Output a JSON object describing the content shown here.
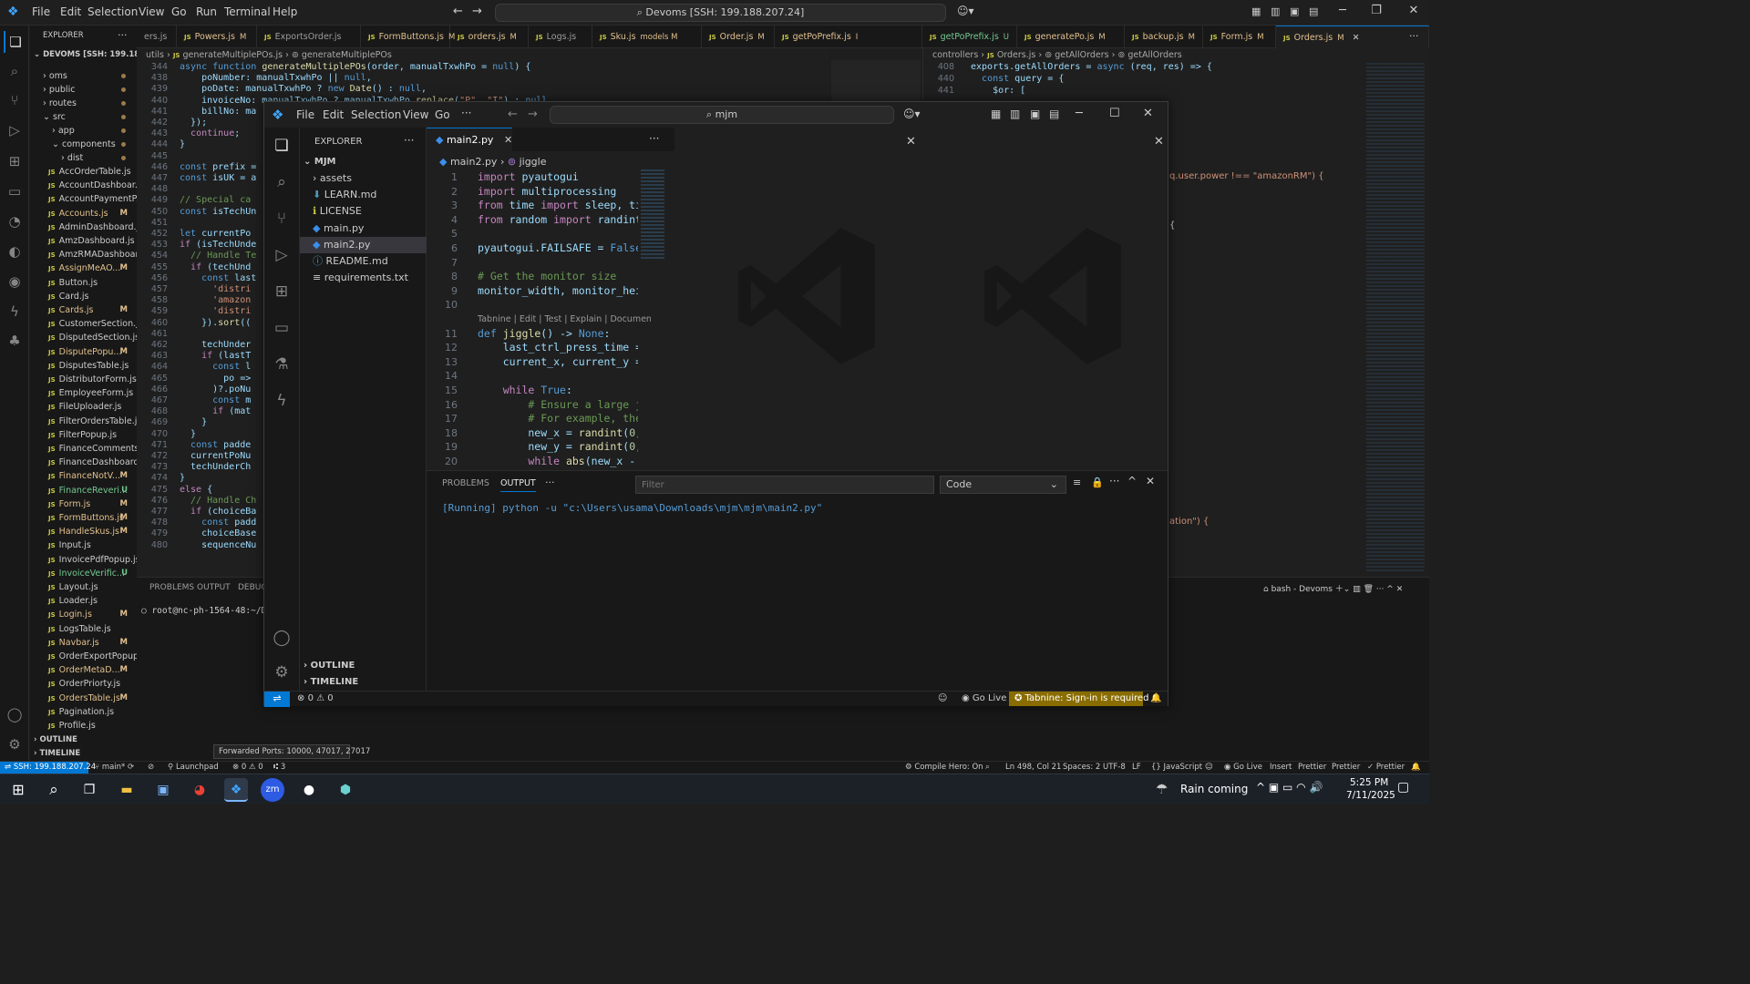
{
  "main": {
    "menu": [
      "File",
      "Edit",
      "Selection",
      "View",
      "Go",
      "Run",
      "Terminal",
      "Help"
    ],
    "search": "Devoms [SSH: 199.188.207.24]",
    "explorer_title": "EXPLORER",
    "workspace": "DEVOMS [SSH: 199.188.20...",
    "folders": [
      "oms",
      "public",
      "routes",
      "src",
      "app",
      "components",
      "dist"
    ],
    "files": [
      {
        "name": "AccOrderTable.js",
        "status": ""
      },
      {
        "name": "AccountDashboar...",
        "status": ""
      },
      {
        "name": "AccountPaymentP...",
        "status": ""
      },
      {
        "name": "Accounts.js",
        "status": "M"
      },
      {
        "name": "AdminDashboard.js",
        "status": ""
      },
      {
        "name": "AmzDashboard.js",
        "status": ""
      },
      {
        "name": "AmzRMADashboar...",
        "status": ""
      },
      {
        "name": "AssignMeAO...",
        "status": "M"
      },
      {
        "name": "Button.js",
        "status": ""
      },
      {
        "name": "Card.js",
        "status": ""
      },
      {
        "name": "Cards.js",
        "status": "M"
      },
      {
        "name": "CustomerSection.js",
        "status": ""
      },
      {
        "name": "DisputedSection.js",
        "status": ""
      },
      {
        "name": "DisputePopu...",
        "status": "M"
      },
      {
        "name": "DisputesTable.js",
        "status": ""
      },
      {
        "name": "DistributorForm.js",
        "status": ""
      },
      {
        "name": "EmployeeForm.js",
        "status": ""
      },
      {
        "name": "FileUploader.js",
        "status": ""
      },
      {
        "name": "FilterOrdersTable.js",
        "status": ""
      },
      {
        "name": "FilterPopup.js",
        "status": ""
      },
      {
        "name": "FinanceComments.js",
        "status": ""
      },
      {
        "name": "FinanceDashboard.js",
        "status": ""
      },
      {
        "name": "FinanceNotV...",
        "status": "M"
      },
      {
        "name": "FinanceReveri...",
        "status": "U"
      },
      {
        "name": "Form.js",
        "status": "M"
      },
      {
        "name": "FormButtons.js",
        "status": "M"
      },
      {
        "name": "HandleSkus.js",
        "status": "M"
      },
      {
        "name": "Input.js",
        "status": ""
      },
      {
        "name": "InvoicePdfPopup.js",
        "status": ""
      },
      {
        "name": "InvoiceVerific...",
        "status": "U"
      },
      {
        "name": "Layout.js",
        "status": ""
      },
      {
        "name": "Loader.js",
        "status": ""
      },
      {
        "name": "Login.js",
        "status": "M"
      },
      {
        "name": "LogsTable.js",
        "status": ""
      },
      {
        "name": "Navbar.js",
        "status": "M"
      },
      {
        "name": "OrderExportPopup.js",
        "status": ""
      },
      {
        "name": "OrderMetaD...",
        "status": "M"
      },
      {
        "name": "OrderPriorty.js",
        "status": ""
      },
      {
        "name": "OrdersTable.js",
        "status": "M"
      },
      {
        "name": "Pagination.js",
        "status": ""
      },
      {
        "name": "Profile.js",
        "status": ""
      }
    ],
    "outline": "OUTLINE",
    "timeline": "TIMELINE",
    "tabs": [
      {
        "name": "ers.js",
        "status": ""
      },
      {
        "name": "Powers.js",
        "status": "M"
      },
      {
        "name": "ExportsOrder.js",
        "status": ""
      },
      {
        "name": "FormButtons.js",
        "status": "M"
      },
      {
        "name": "orders.js",
        "status": "M"
      },
      {
        "name": "Logs.js",
        "status": ""
      },
      {
        "name": "Sku.js",
        "status": "models M"
      },
      {
        "name": "Order.js",
        "status": "M"
      },
      {
        "name": "getPoPrefix.js",
        "status": "I"
      },
      {
        "name": "getPoPrefix.js",
        "status": "U"
      },
      {
        "name": "generatePo.js",
        "status": "M"
      },
      {
        "name": "backup.js",
        "status": "M"
      },
      {
        "name": "Form.js",
        "status": "M"
      },
      {
        "name": "Orders.js",
        "status": "M"
      }
    ],
    "breadcrumb_left": [
      "utils",
      "generateMultiplePOs.js",
      "generateMultiplePOs"
    ],
    "breadcrumb_right": [
      "controllers",
      "Orders.js",
      "getAllOrders",
      "getAllOrders"
    ],
    "left_code": [
      {
        "n": "344",
        "t": "async function generateMultiplePOs(order, manualTxwhPo = null) {"
      },
      {
        "n": "438",
        "t": "    poNumber: manualTxwhPo || null,"
      },
      {
        "n": "439",
        "t": "    poDate: manualTxwhPo ? new Date() : null,"
      },
      {
        "n": "440",
        "t": "    invoiceNo: manualTxwhPo ? manualTxwhPo.replace(\"P\", \"I\") : null,"
      },
      {
        "n": "441",
        "t": "    billNo: ma"
      },
      {
        "n": "442",
        "t": "  });"
      },
      {
        "n": "443",
        "t": "  continue;"
      },
      {
        "n": "444",
        "t": "}"
      },
      {
        "n": "445",
        "t": ""
      },
      {
        "n": "446",
        "t": "const prefix ="
      },
      {
        "n": "447",
        "t": "const isUK = a"
      },
      {
        "n": "448",
        "t": ""
      },
      {
        "n": "449",
        "t": "// Special ca"
      },
      {
        "n": "450",
        "t": "const isTechUn"
      },
      {
        "n": "451",
        "t": ""
      },
      {
        "n": "452",
        "t": "let currentPo"
      },
      {
        "n": "453",
        "t": "if (isTechUnde"
      },
      {
        "n": "454",
        "t": "  // Handle Te"
      },
      {
        "n": "455",
        "t": "  if (techUnd"
      },
      {
        "n": "456",
        "t": "    const last"
      },
      {
        "n": "457",
        "t": "      'distri"
      },
      {
        "n": "458",
        "t": "      'amazon"
      },
      {
        "n": "459",
        "t": "      'distri"
      },
      {
        "n": "460",
        "t": "    }).sort(("
      },
      {
        "n": "461",
        "t": ""
      },
      {
        "n": "462",
        "t": "    techUnder"
      },
      {
        "n": "463",
        "t": "    if (lastT"
      },
      {
        "n": "464",
        "t": "      const l"
      },
      {
        "n": "465",
        "t": "        po =>"
      },
      {
        "n": "466",
        "t": "      )?.poNu"
      },
      {
        "n": "467",
        "t": "      const m"
      },
      {
        "n": "468",
        "t": "      if (mat"
      },
      {
        "n": "469",
        "t": "    }"
      },
      {
        "n": "470",
        "t": "  }"
      },
      {
        "n": "471",
        "t": "  const padde"
      },
      {
        "n": "472",
        "t": "  currentPoNu"
      },
      {
        "n": "473",
        "t": "  techUnderCh"
      },
      {
        "n": "474",
        "t": "}"
      },
      {
        "n": "475",
        "t": "else {"
      },
      {
        "n": "476",
        "t": "  // Handle Ch"
      },
      {
        "n": "477",
        "t": "  if (choiceBa"
      },
      {
        "n": "478",
        "t": "    const padd"
      },
      {
        "n": "479",
        "t": "    choiceBase"
      },
      {
        "n": "480",
        "t": "    sequenceNu"
      }
    ],
    "right_code": [
      {
        "n": "408",
        "t": "exports.getAllOrders = async (req, res) => {"
      },
      {
        "n": "440",
        "t": "  const query = {"
      },
      {
        "n": "441",
        "t": "    $or: ["
      }
    ],
    "right_fragments": [
      "q.user.power !== \"amazonRM\") {",
      "{",
      "ation\") {"
    ],
    "panel_tabs": [
      "PROBLEMS",
      "OUTPUT",
      "DEBUG C"
    ],
    "terminal_line": "root@nc-ph-1564-48:~/Devom",
    "terminal_name": "bash - Devoms",
    "tooltip": "Forwarded Ports: 10000, 47017, 27017"
  },
  "overlay": {
    "menu": [
      "File",
      "Edit",
      "Selection",
      "View",
      "Go"
    ],
    "search": "mjm",
    "explorer_title": "EXPLORER",
    "folder": "MJM",
    "files": [
      "assets",
      "LEARN.md",
      "LICENSE",
      "main.py",
      "main2.py",
      "README.md",
      "requirements.txt"
    ],
    "tab": "main2.py",
    "breadcrumb": [
      "main2.py",
      "jiggle"
    ],
    "code": [
      {
        "n": "1",
        "t": "import pyautogui"
      },
      {
        "n": "2",
        "t": "import multiprocessing"
      },
      {
        "n": "3",
        "t": "from time import sleep, time"
      },
      {
        "n": "4",
        "t": "from random import randint,"
      },
      {
        "n": "5",
        "t": ""
      },
      {
        "n": "6",
        "t": "pyautogui.FAILSAFE = False"
      },
      {
        "n": "7",
        "t": ""
      },
      {
        "n": "8",
        "t": "# Get the monitor size"
      },
      {
        "n": "9",
        "t": "monitor_width, monitor_heigh"
      },
      {
        "n": "10",
        "t": ""
      },
      {
        "n": "",
        "t": "Tabnine | Edit | Test | Explain | Document"
      },
      {
        "n": "11",
        "t": "def jiggle() -> None:"
      },
      {
        "n": "12",
        "t": "    last_ctrl_press_time = t"
      },
      {
        "n": "13",
        "t": "    current_x, current_y = p"
      },
      {
        "n": "14",
        "t": ""
      },
      {
        "n": "15",
        "t": "    while True:"
      },
      {
        "n": "16",
        "t": "        # Ensure a large jum"
      },
      {
        "n": "17",
        "t": "        # For example, the n"
      },
      {
        "n": "18",
        "t": "        new_x = randint(0, m"
      },
      {
        "n": "19",
        "t": "        new_y = randint(0, m"
      },
      {
        "n": "20",
        "t": "        while abs(new_x - cu"
      }
    ],
    "panel_tabs": [
      "PROBLEMS",
      "OUTPUT"
    ],
    "filter_placeholder": "Filter",
    "output_select": "Code",
    "output_line": "[Running] python -u \"c:\\Users\\usama\\Downloads\\mjm\\mjm\\main2.py\"",
    "outline": "OUTLINE",
    "timeline": "TIMELINE",
    "status_errors": "0",
    "status_warnings": "0",
    "go_live": "Go Live",
    "tabnine": "Tabnine: Sign-in is required"
  },
  "status": {
    "remote": "SSH: 199.188.207.24",
    "branch": "main*",
    "launchpad": "Launchpad",
    "errors": "0",
    "warnings": "0",
    "ports": "3",
    "compile_hero": "Compile Hero: On",
    "position": "Ln 498, Col 21",
    "spaces": "Spaces: 2",
    "encoding": "UTF-8",
    "eol": "LF",
    "language": "JavaScript",
    "go_live": "Go Live",
    "insert": "Insert",
    "prettier1": "Prettier",
    "prettier2": "Prettier",
    "prettier3": "Prettier"
  },
  "taskbar": {
    "weather": "Rain coming",
    "time": "5:25 PM",
    "date": "7/11/2025"
  },
  "colors": {
    "accent": "#0078d4",
    "modified": "#e2c08d",
    "untracked": "#73c991",
    "tabnine": "#8a6d00"
  }
}
